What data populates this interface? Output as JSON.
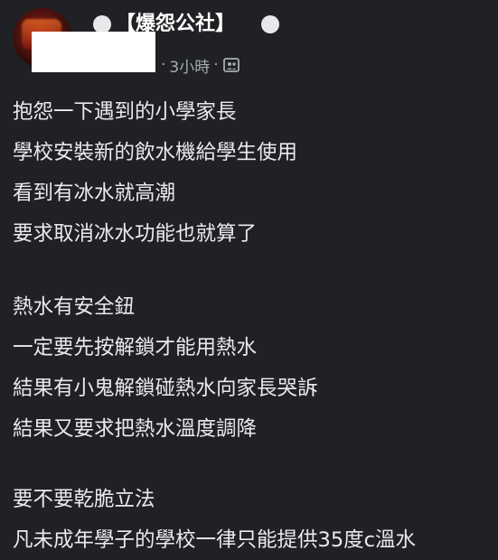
{
  "post": {
    "group_name": "【爆怨公社】",
    "timestamp": "3小時",
    "separator_before": "·",
    "separator_after": "·",
    "privacy_icon": "group-members-icon",
    "body_lines": [
      "抱怨一下遇到的小學家長",
      "學校安裝新的飲水機給學生使用",
      "看到有冰水就高潮",
      "要求取消冰水功能也就算了",
      "",
      "熱水有安全鈕",
      "一定要先按解鎖才能用熱水",
      "結果有小鬼解鎖碰熱水向家長哭訴",
      "結果又要求把熱水溫度調降",
      "",
      "要不要乾脆立法",
      "凡未成年學子的學校一律只能提供35度c溫水"
    ]
  },
  "colors": {
    "background": "#202124",
    "text": "#e9eaee",
    "meta": "#a8abb0",
    "redaction": "#ffffff"
  }
}
